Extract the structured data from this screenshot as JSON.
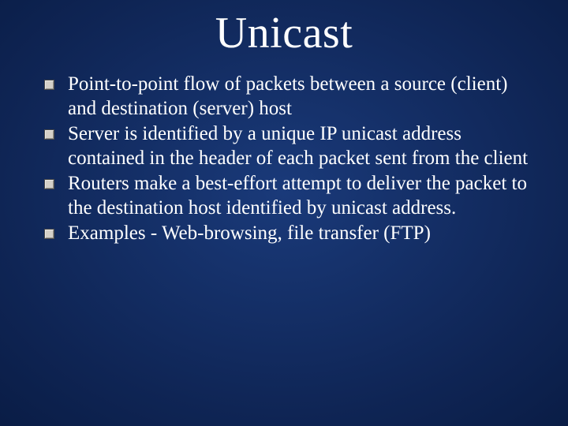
{
  "slide": {
    "title": "Unicast",
    "bullets": [
      "Point-to-point flow of packets between a source (client) and destination (server) host",
      "Server is identified by a unique IP unicast address contained in the header of each packet sent from the client",
      " Routers make a best-effort attempt to deliver the packet to the destination host identified by unicast address.",
      " Examples - Web-browsing,  file transfer (FTP)"
    ]
  }
}
